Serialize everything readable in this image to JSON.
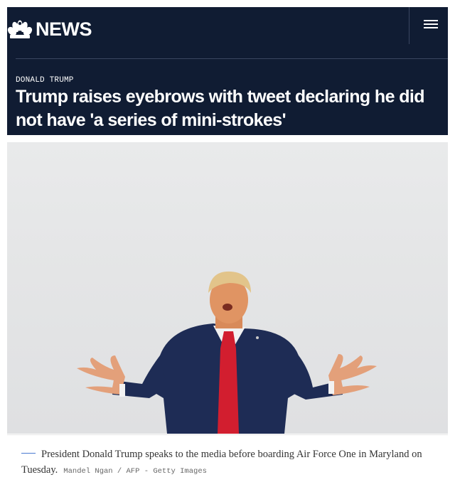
{
  "header": {
    "logo_text": "NEWS",
    "logo_icon": "peacock-icon",
    "menu_icon": "hamburger-menu-icon",
    "background_color": "#101c33"
  },
  "article": {
    "kicker": "DONALD TRUMP",
    "headline": "Trump raises eyebrows with tweet declaring he did not have 'a series of mini-strokes'"
  },
  "photo": {
    "caption": "President Donald Trump speaks to the media before boarding Air Force One in Maryland on Tuesday.",
    "credit": "Mandel Ngan / AFP - Getty Images"
  },
  "colors": {
    "accent": "#4a7bd0",
    "header_bg": "#101c33"
  }
}
